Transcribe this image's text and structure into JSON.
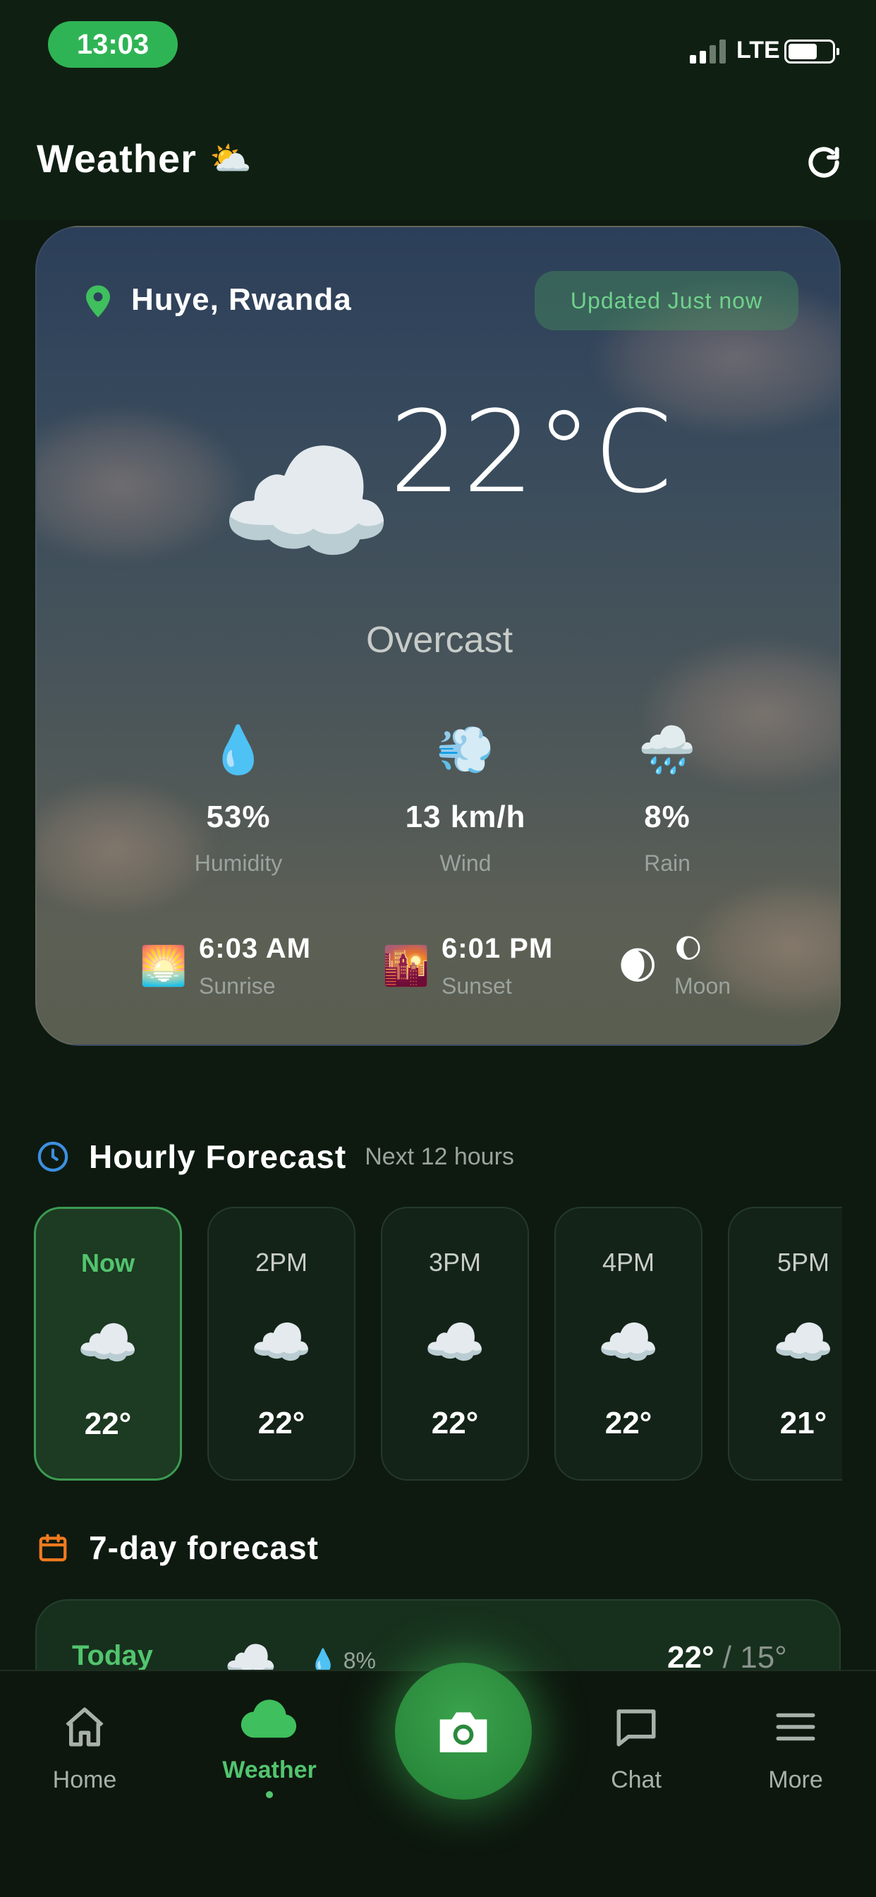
{
  "status_bar": {
    "time": "13:03",
    "network": "LTE"
  },
  "header": {
    "title": "Weather",
    "title_icon": "⛅"
  },
  "hero": {
    "location": "Huye, Rwanda",
    "updated": "Updated Just now",
    "icon": "☁️",
    "temperature": "22°C",
    "condition": "Overcast",
    "stats": [
      {
        "icon": "💧",
        "value": "53%",
        "label": "Humidity"
      },
      {
        "icon": "💨",
        "value": "13 km/h",
        "label": "Wind"
      },
      {
        "icon": "🌧️",
        "value": "8%",
        "label": "Rain"
      }
    ],
    "sunrise": {
      "icon": "🌅",
      "time": "6:03 AM",
      "label": "Sunrise"
    },
    "sunset": {
      "icon": "🌇",
      "time": "6:01 PM",
      "label": "Sunset"
    },
    "moon": {
      "icon": "🌒",
      "phase_icon": "🌔",
      "label": "Moon"
    }
  },
  "hourly": {
    "title": "Hourly Forecast",
    "subtitle": "Next 12 hours",
    "items": [
      {
        "hour": "Now",
        "icon": "☁️",
        "temp": "22°"
      },
      {
        "hour": "2PM",
        "icon": "☁️",
        "temp": "22°"
      },
      {
        "hour": "3PM",
        "icon": "☁️",
        "temp": "22°"
      },
      {
        "hour": "4PM",
        "icon": "☁️",
        "temp": "22°"
      },
      {
        "hour": "5PM",
        "icon": "☁️",
        "temp": "21°"
      }
    ]
  },
  "weekly": {
    "title": "7-day forecast",
    "today": {
      "day": "Today",
      "icon": "☁️",
      "rain": "8%",
      "high": "22°",
      "sep": " / ",
      "low": "15°"
    }
  },
  "nav": {
    "items": [
      {
        "label": "Home",
        "icon": "home-icon"
      },
      {
        "label": "Weather",
        "icon": "cloud-icon"
      },
      {
        "label": "Chat",
        "icon": "chat-icon"
      },
      {
        "label": "More",
        "icon": "menu-icon"
      }
    ],
    "camera_icon": "camera-icon"
  },
  "colors": {
    "accent": "#52c46e",
    "pill": "#2fb455",
    "background": "#0e1a10"
  }
}
